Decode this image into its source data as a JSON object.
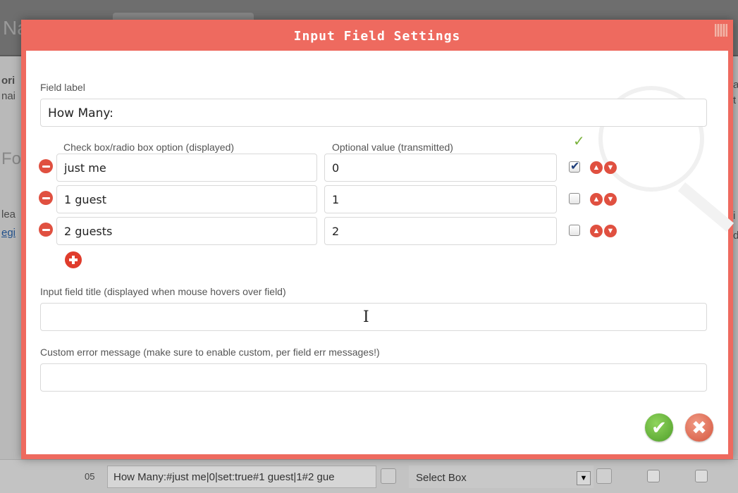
{
  "background": {
    "bottom_row": {
      "row_number": "05",
      "value": "How Many:#just me|0|set:true#1 guest|1#2 gue",
      "type": "Select Box"
    },
    "fragments": {
      "left_1": "ori",
      "left_2": "nai",
      "left_3": "Fo",
      "left_4": "lea",
      "left_link": "egi",
      "right_1": "a",
      "right_2": "t",
      "right_3": "i",
      "right_4": "d",
      "na": "Na"
    }
  },
  "modal": {
    "title": "Input Field Settings",
    "field_label": {
      "label": "Field label",
      "value": "How Many:"
    },
    "options": {
      "col_option_header": "Check box/radio box option (displayed)",
      "col_value_header": "Optional value (transmitted)",
      "rows": [
        {
          "option": "just me",
          "value": "0",
          "checked": true
        },
        {
          "option": "1 guest",
          "value": "1",
          "checked": false
        },
        {
          "option": "2 guests",
          "value": "2",
          "checked": false
        }
      ]
    },
    "title_field": {
      "label": "Input field title (displayed when mouse hovers over field)",
      "value": ""
    },
    "error_field": {
      "label": "Custom error message (make sure to enable custom, per field err messages!)",
      "value": ""
    }
  }
}
